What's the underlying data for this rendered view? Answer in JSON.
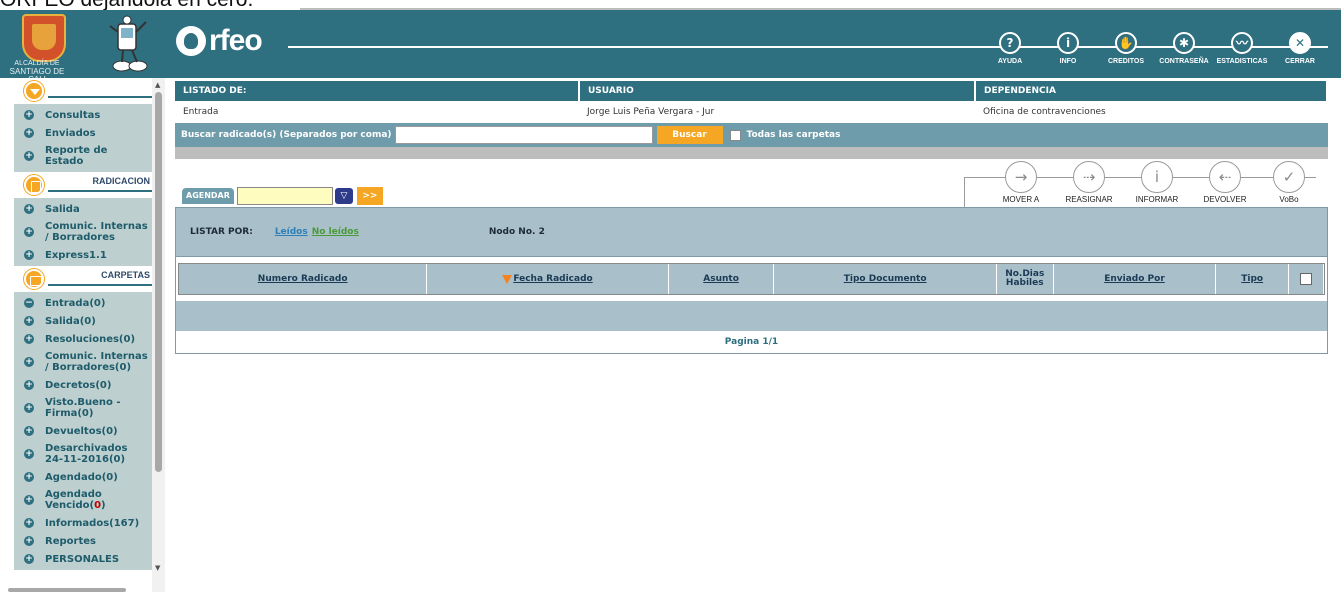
{
  "caption": "ORFEO dejandola en cero.",
  "header": {
    "logo_line1": "ALCALDÍA DE",
    "logo_line2": "SANTIAGO DE CALI",
    "app_name": "rfeo",
    "nav": [
      {
        "label": "AYUDA",
        "glyph": "?"
      },
      {
        "label": "INFO",
        "glyph": "i"
      },
      {
        "label": "CREDITOS",
        "glyph": "✋"
      },
      {
        "label": "CONTRASEÑA",
        "glyph": "✱"
      },
      {
        "label": "ESTADISTICAS",
        "glyph": "〰"
      },
      {
        "label": "CERRAR",
        "glyph": "✕"
      }
    ]
  },
  "sidebar": {
    "menu_items": [
      "Consultas",
      "Enviados",
      "Reporte de Estado"
    ],
    "radicacion": {
      "title": "RADICACION",
      "items": [
        "Salida",
        "Comunic. Internas / Borradores",
        "Express1.1"
      ]
    },
    "carpetas": {
      "title": "CARPETAS",
      "items": [
        {
          "label": "Entrada(0)",
          "bullet": "−"
        },
        {
          "label": "Salida(0)",
          "bullet": "+"
        },
        {
          "label": "Resoluciones(0)",
          "bullet": "+"
        },
        {
          "label": "Comunic. Internas / Borradores(0)",
          "bullet": "+"
        },
        {
          "label": "Decretos(0)",
          "bullet": "+"
        },
        {
          "label": "Visto.Bueno - Firma(0)",
          "bullet": "+"
        },
        {
          "label": "Devueltos(0)",
          "bullet": "+"
        },
        {
          "label": "Desarchivados 24-11-2016(0)",
          "bullet": "+"
        },
        {
          "label": "Agendado(0)",
          "bullet": "+"
        },
        {
          "label": "Agendado Vencido(",
          "red": "0",
          "after": ")",
          "bullet": "+"
        },
        {
          "label": "Informados(167)",
          "bullet": "+"
        },
        {
          "label": "Reportes",
          "bullet": "+"
        },
        {
          "label": "PERSONALES",
          "bullet": "+"
        }
      ]
    }
  },
  "info": {
    "listado_label": "LISTADO DE:",
    "usuario_label": "USUARIO",
    "dependencia_label": "DEPENDENCIA",
    "listado_value": "Entrada",
    "usuario_value": "Jorge Luis Peña Vergara - Jur",
    "dependencia_value": "Oficina de contravenciones"
  },
  "search": {
    "label": "Buscar radicado(s) (Separados por coma)",
    "value": "",
    "button": "Buscar",
    "all_folders_label": "Todas las carpetas",
    "all_folders_checked": false
  },
  "agendar": {
    "tab": "AGENDAR",
    "date_value": "",
    "go_label": ">>"
  },
  "actions": [
    {
      "label": "MOVER A",
      "glyph": "→"
    },
    {
      "label": "REASIGNAR",
      "glyph": "⇢"
    },
    {
      "label": "INFORMAR",
      "glyph": "i"
    },
    {
      "label": "DEVOLVER",
      "glyph": "⇠"
    },
    {
      "label": "VoBo",
      "glyph": "✓"
    }
  ],
  "listar": {
    "label": "LISTAR POR:",
    "leidos": "Leídos",
    "no_leidos": "No leídos",
    "nodo": "Nodo No. 2"
  },
  "table": {
    "columns": [
      "Numero Radicado",
      "Fecha Radicado",
      "Asunto",
      "Tipo Documento",
      "No.Dias Habiles",
      "Enviado Por",
      "Tipo"
    ],
    "rows": []
  },
  "pagination": "Pagina 1/1",
  "colors": {
    "header": "#2e6f80",
    "accent": "#f5a623",
    "sidebar_bg": "#bdd0cf",
    "table_head": "#a9c0ca"
  }
}
